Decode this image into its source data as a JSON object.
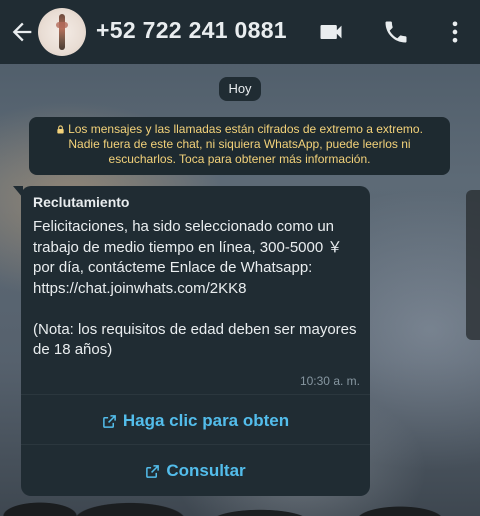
{
  "header": {
    "contact_name": "+52 722 241 0881",
    "icons": [
      "back-arrow-icon",
      "avatar",
      "video-call-icon",
      "phone-icon",
      "more-options-icon"
    ]
  },
  "chat": {
    "date_label": "Hoy",
    "encryption_notice": "Los mensajes y las llamadas están cifrados de extremo a extremo. Nadie fuera de este chat, ni siquiera WhatsApp, puede leerlos ni escucharlos. Toca para obtener más información.",
    "message": {
      "sender": "Reclutamiento",
      "text": "Felicitaciones, ha sido seleccionado como un trabajo de medio tiempo en línea, 300-5000 ￥ por día, contácteme Enlace de Whatsapp: https://chat.joinwhats.com/2KK8\n\n (Nota: los requisitos de edad deben ser mayores de 18 años)",
      "time": "10:30 a. m.",
      "buttons": [
        {
          "label": "Haga clic para obten",
          "icon": "external-link-icon"
        },
        {
          "label": "Consultar",
          "icon": "external-link-icon"
        }
      ]
    }
  },
  "colors": {
    "header_bg": "#202c33",
    "bubble_bg": "#202c33",
    "notice_text": "#f3d27a",
    "link_blue": "#53bdeb",
    "text_primary": "#e9edef",
    "text_secondary": "#8696a0"
  }
}
